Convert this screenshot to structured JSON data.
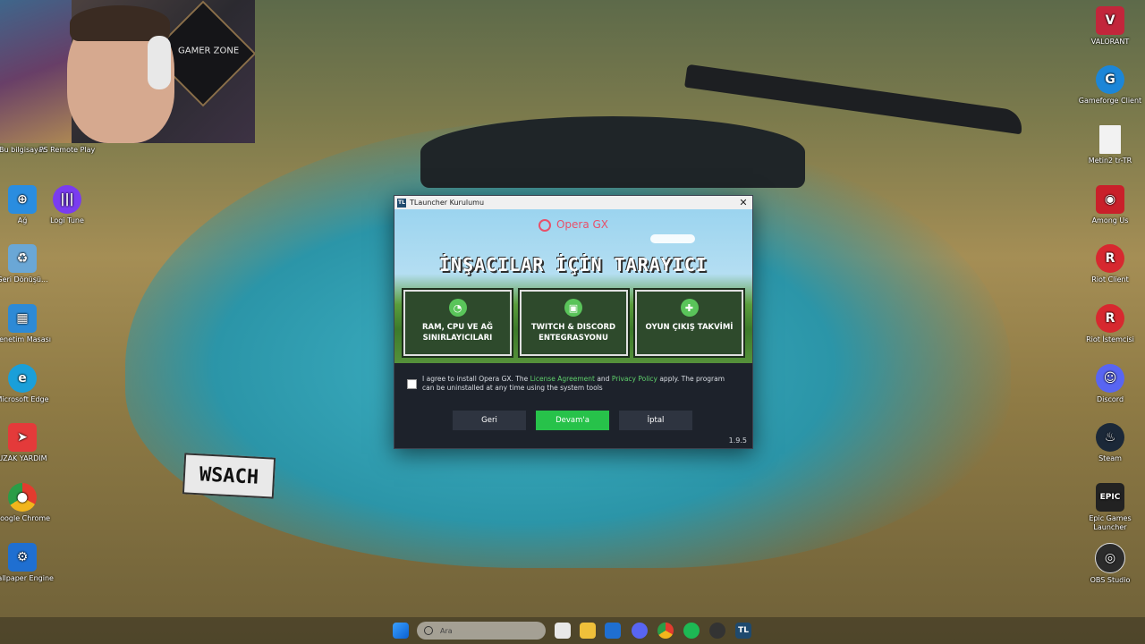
{
  "desktop": {
    "left_icons": [
      {
        "label": "Bu bilgisayar",
        "icon": "computer-icon",
        "color": "#3b8fd9"
      },
      {
        "label": "PS Remote Play",
        "icon": "playstation-icon",
        "color": "#1d4ea8"
      },
      {
        "label": "Ağ",
        "icon": "network-icon",
        "color": "#2a8de0"
      },
      {
        "label": "Logi Tune",
        "icon": "logi-tune-icon",
        "color": "#7a3cf0"
      },
      {
        "label": "Geri Dönüşü...",
        "icon": "recycle-bin-icon",
        "color": "#6aa7d6"
      },
      {
        "label": "Denetim Masası",
        "icon": "control-panel-icon",
        "color": "#2d8ad6"
      },
      {
        "label": "Microsoft Edge",
        "icon": "edge-icon",
        "color": "#1a9fd9"
      },
      {
        "label": "UZAK YARDIM",
        "icon": "remote-assist-icon",
        "color": "#e43a3a"
      },
      {
        "label": "Google Chrome",
        "icon": "chrome-icon",
        "color": "#e8a21f"
      },
      {
        "label": "Wallpaper Engine",
        "icon": "wallpaper-engine-icon",
        "color": "#1f6fd1"
      }
    ],
    "right_icons": [
      {
        "label": "VALORANT",
        "icon": "valorant-icon",
        "color": "#c2263b"
      },
      {
        "label": "Gameforge Client",
        "icon": "gameforge-icon",
        "color": "#1c86d8"
      },
      {
        "label": "Metin2 tr-TR",
        "icon": "file-icon",
        "color": "#f2f2f2"
      },
      {
        "label": "Among Us",
        "icon": "among-us-icon",
        "color": "#c9202a"
      },
      {
        "label": "Riot Client",
        "icon": "riot-icon",
        "color": "#d7282f"
      },
      {
        "label": "Riot İstemcisi",
        "icon": "riot-icon",
        "color": "#d7282f"
      },
      {
        "label": "Discord",
        "icon": "discord-icon",
        "color": "#5865f2"
      },
      {
        "label": "Steam",
        "icon": "steam-icon",
        "color": "#1b2838"
      },
      {
        "label": "Epic Games Launcher",
        "icon": "epic-games-icon",
        "color": "#222222"
      },
      {
        "label": "OBS Studio",
        "icon": "obs-icon",
        "color": "#2b2b2b"
      }
    ],
    "webcam_sign": "GAMER ZONE",
    "plate": "WSACH"
  },
  "dialog": {
    "title": "TLauncher Kurulumu",
    "brand": "Opera GX",
    "headline": "İNŞACILAR İÇİN TARAYICI",
    "features": [
      {
        "line1": "RAM, CPU VE AĞ",
        "line2": "SINIRLAYICILARI",
        "icon": "gauge-icon"
      },
      {
        "line1": "TWITCH & DISCORD",
        "line2": "ENTEGRASYONU",
        "icon": "twitch-icon"
      },
      {
        "line1": "OYUN ÇIKIŞ TAKVİMİ",
        "line2": "",
        "icon": "gamepad-icon"
      }
    ],
    "agree_prefix": "I agree to install Opera GX. The ",
    "license_link": "License Agreement",
    "agree_and": " and ",
    "privacy_link": "Privacy Policy",
    "agree_suffix": " apply. The program can be uninstalled at any time using the system tools",
    "back_label": "Geri",
    "continue_label": "Devam'a",
    "cancel_label": "İptal",
    "version": "1.9.5",
    "colors": {
      "accent": "#27c24a",
      "panel": "#1d222b",
      "link": "#5fd06b"
    }
  },
  "taskbar": {
    "search_placeholder": "Ara",
    "active_app": "TL"
  }
}
